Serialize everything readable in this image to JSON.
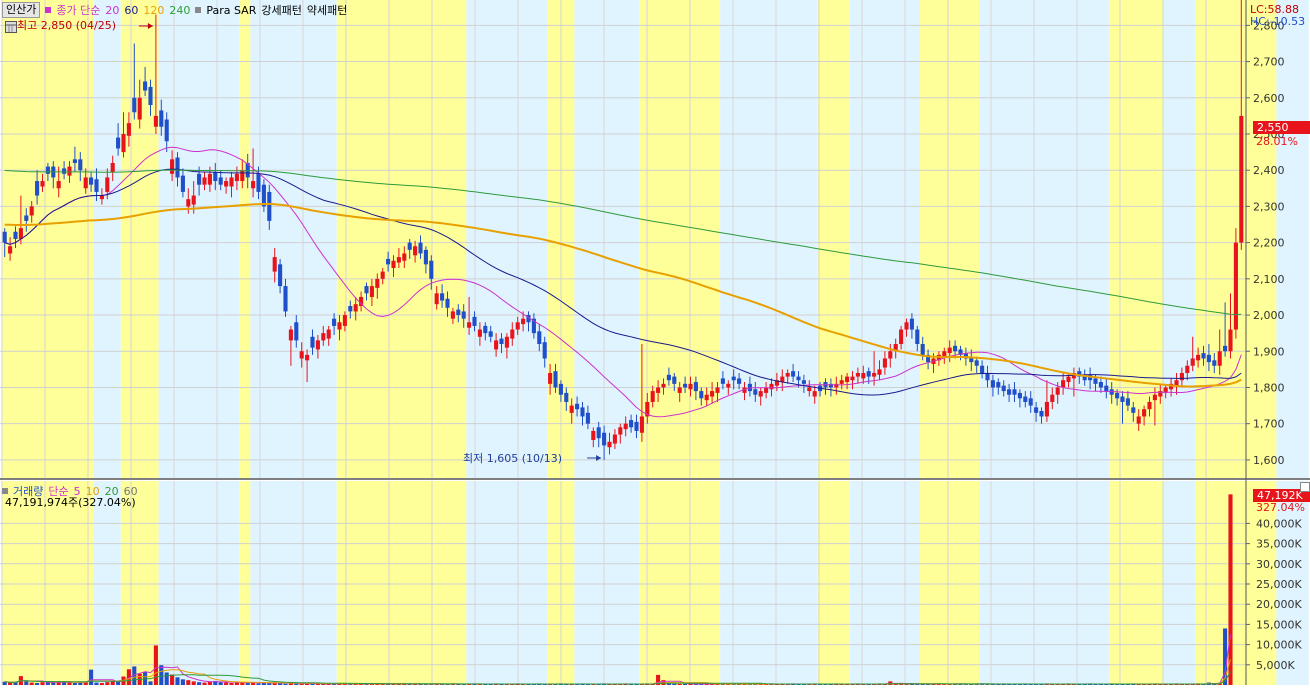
{
  "price_panel": {
    "button_label": "인산가",
    "legend_label": "종가 단순",
    "ma_periods": [
      "20",
      "60",
      "120",
      "240"
    ],
    "ma_colors": [
      "#cc33cc",
      "#1a1a8c",
      "#e8a000",
      "#2e9a3c"
    ],
    "sar_label": "Para SAR",
    "pattern_strong": "강세패턴",
    "pattern_weak": "약세패턴",
    "high_annotation": "최고 2,850 (04/25)",
    "low_annotation": "최저 1,605 (10/13)",
    "lc_text": "LC:58.88",
    "hc_text": "HC:-10.53",
    "last_price_box": "2,550",
    "last_change": "28.01%"
  },
  "volume_panel": {
    "legend_label": "거래량",
    "legend_ma_label": "단순",
    "ma_periods": [
      "5",
      "10",
      "20",
      "60"
    ],
    "ma_colors": [
      "#cc33cc",
      "#e8a000",
      "#2e9a3c",
      "#888888"
    ],
    "info_text": "47,191,974주(327.04%)",
    "last_volume_box": "47,192K",
    "last_volume_change": "327.04%"
  },
  "colors": {
    "up": "#e8141b",
    "down": "#1f4fc9",
    "strong_band": "#ffff99",
    "weak_band": "#e0f4ff",
    "ma20": "#cc33cc",
    "ma60": "#1a1a8c",
    "ma120": "#e8a000",
    "ma240": "#2e9a3c",
    "last_box": "#e8141b"
  },
  "chart_data": [
    {
      "type": "candlestick",
      "ylim": [
        1550,
        2870
      ],
      "y_ticks": [
        1600,
        1700,
        1800,
        1900,
        2000,
        2100,
        2200,
        2300,
        2400,
        2500,
        2600,
        2700,
        2800
      ],
      "y_tick_labels": [
        "1,600",
        "1,700",
        "1,800",
        "1,900",
        "2,000",
        "2,100",
        "2,200",
        "2,300",
        "2,400",
        "2,500",
        "2,600",
        "2,700",
        "2,800"
      ],
      "band_pattern": [
        [
          "s",
          0,
          17
        ],
        [
          "w",
          17,
          22
        ],
        [
          "s",
          22,
          29
        ],
        [
          "w",
          29,
          44
        ],
        [
          "s",
          44,
          46
        ],
        [
          "w",
          46,
          62
        ],
        [
          "s",
          62,
          86
        ],
        [
          "w",
          86,
          101
        ],
        [
          "s",
          101,
          106
        ],
        [
          "w",
          106,
          118
        ],
        [
          "s",
          118,
          133
        ],
        [
          "w",
          133,
          151
        ],
        [
          "s",
          151,
          157
        ],
        [
          "w",
          157,
          170
        ],
        [
          "s",
          170,
          181
        ],
        [
          "w",
          181,
          205
        ],
        [
          "s",
          205,
          215
        ],
        [
          "w",
          215,
          221
        ],
        [
          "s",
          221,
          236
        ],
        [
          "w",
          236,
          242
        ]
      ],
      "close": [
        2200,
        2190,
        2210,
        2240,
        2260,
        2300,
        2330,
        2370,
        2390,
        2380,
        2370,
        2390,
        2410,
        2420,
        2400,
        2380,
        2360,
        2340,
        2330,
        2380,
        2420,
        2460,
        2500,
        2530,
        2560,
        2600,
        2620,
        2580,
        2550,
        2520,
        2480,
        2430,
        2380,
        2340,
        2320,
        2330,
        2360,
        2380,
        2390,
        2370,
        2360,
        2370,
        2380,
        2390,
        2400,
        2380,
        2370,
        2340,
        2300,
        2260,
        2160,
        2080,
        2010,
        1960,
        1930,
        1900,
        1890,
        1910,
        1930,
        1950,
        1960,
        1970,
        1980,
        2000,
        2010,
        2030,
        2050,
        2060,
        2080,
        2100,
        2120,
        2140,
        2150,
        2160,
        2170,
        2180,
        2190,
        2170,
        2140,
        2100,
        2060,
        2040,
        2020,
        2010,
        2000,
        1990,
        1980,
        1970,
        1960,
        1950,
        1940,
        1930,
        1920,
        1940,
        1960,
        1980,
        1990,
        1980,
        1950,
        1920,
        1880,
        1840,
        1800,
        1780,
        1760,
        1750,
        1740,
        1720,
        1700,
        1680,
        1660,
        1640,
        1650,
        1670,
        1690,
        1700,
        1690,
        1680,
        1720,
        1760,
        1790,
        1800,
        1810,
        1820,
        1810,
        1800,
        1800,
        1810,
        1790,
        1770,
        1780,
        1790,
        1800,
        1810,
        1810,
        1820,
        1810,
        1800,
        1790,
        1780,
        1790,
        1800,
        1810,
        1820,
        1830,
        1840,
        1830,
        1820,
        1810,
        1800,
        1790,
        1790,
        1800,
        1800,
        1810,
        1820,
        1830,
        1830,
        1840,
        1840,
        1830,
        1840,
        1850,
        1880,
        1900,
        1920,
        1960,
        1980,
        1960,
        1920,
        1890,
        1870,
        1880,
        1890,
        1900,
        1910,
        1900,
        1890,
        1880,
        1870,
        1860,
        1840,
        1820,
        1800,
        1800,
        1790,
        1780,
        1780,
        1770,
        1760,
        1750,
        1730,
        1720,
        1760,
        1780,
        1800,
        1820,
        1830,
        1840,
        1830,
        1820,
        1820,
        1810,
        1800,
        1790,
        1780,
        1770,
        1760,
        1750,
        1730,
        1720,
        1740,
        1760,
        1780,
        1790,
        1800,
        1810,
        1820,
        1840,
        1860,
        1880,
        1890,
        1880,
        1870,
        1860,
        1900,
        1900,
        1960,
        2200,
        2550
      ],
      "open_shift": [
        30,
        -20,
        20,
        -30,
        15,
        -25,
        40,
        -15,
        20,
        30,
        -20,
        15,
        -25,
        10,
        30,
        -30,
        20,
        35,
        -10,
        -40,
        -25,
        30,
        -50,
        -35,
        40,
        -60,
        25,
        50,
        -30,
        45,
        60,
        -40,
        55,
        45,
        -20,
        -25,
        30,
        -20,
        -30,
        25,
        20,
        -15,
        -25,
        -20,
        -30,
        40,
        -20,
        50,
        60,
        80,
        -40,
        60,
        70,
        -30,
        50,
        -20,
        -15,
        30,
        -25,
        -20,
        -25,
        20,
        -20,
        -30,
        15,
        -20,
        -25,
        20,
        -30,
        -25,
        -20,
        15,
        -20,
        -15,
        -20,
        20,
        -25,
        30,
        40,
        50,
        -30,
        20,
        25,
        -20,
        15,
        20,
        -15,
        25,
        -20,
        20,
        15,
        -25,
        15,
        -30,
        -25,
        -20,
        -15,
        20,
        40,
        35,
        45,
        -30,
        45,
        30,
        25,
        -20,
        15,
        25,
        30,
        -25,
        30,
        35,
        -15,
        -25,
        -20,
        -15,
        20,
        25,
        -45,
        -40,
        -30,
        -15,
        -10,
        15,
        20,
        -15,
        10,
        -15,
        25,
        20,
        -15,
        -15,
        -15,
        15,
        -10,
        10,
        15,
        -15,
        20,
        15,
        -15,
        -15,
        -15,
        -15,
        -15,
        -10,
        15,
        10,
        10,
        -10,
        -15,
        15,
        15,
        10,
        -10,
        -10,
        -15,
        -10,
        -10,
        -15,
        15,
        -10,
        -15,
        -25,
        -20,
        -20,
        -40,
        -20,
        30,
        40,
        30,
        20,
        -15,
        -15,
        -15,
        -15,
        15,
        15,
        15,
        15,
        15,
        20,
        20,
        20,
        15,
        15,
        15,
        15,
        15,
        15,
        20,
        15,
        15,
        -40,
        -20,
        -20,
        -20,
        -15,
        -15,
        15,
        15,
        15,
        15,
        15,
        15,
        15,
        15,
        15,
        20,
        15,
        -20,
        -20,
        -20,
        -15,
        -15,
        -15,
        -15,
        -15,
        -20,
        -20,
        -20,
        -15,
        15,
        20,
        15,
        -40,
        15,
        -60,
        -240,
        -350
      ],
      "wick_up": [
        10,
        25,
        15,
        90,
        20,
        15,
        30,
        20,
        10,
        15,
        40,
        20,
        15,
        35,
        20,
        25,
        15,
        30,
        20,
        25,
        20,
        40,
        60,
        30,
        150,
        50,
        40,
        20,
        280,
        30,
        20,
        25,
        15,
        20,
        30,
        40,
        20,
        15,
        20,
        25,
        20,
        10,
        15,
        20,
        30,
        25,
        90,
        20,
        15,
        20,
        25,
        15,
        20,
        10,
        20,
        25,
        15,
        20,
        15,
        20,
        10,
        15,
        20,
        10,
        15,
        20,
        15,
        10,
        20,
        15,
        10,
        20,
        15,
        25,
        20,
        10,
        15,
        20,
        10,
        15,
        20,
        25,
        20,
        10,
        15,
        20,
        70,
        15,
        20,
        10,
        15,
        20,
        15,
        10,
        20,
        15,
        20,
        10,
        15,
        20,
        15,
        25,
        20,
        10,
        15,
        20,
        20,
        15,
        20,
        10,
        15,
        20,
        25,
        15,
        10,
        20,
        15,
        20,
        200,
        25,
        15,
        20,
        15,
        20,
        10,
        15,
        20,
        20,
        15,
        10,
        20,
        25,
        15,
        20,
        10,
        20,
        15,
        15,
        20,
        20,
        10,
        15,
        15,
        20,
        20,
        10,
        20,
        15,
        15,
        20,
        15,
        10,
        10,
        15,
        20,
        15,
        10,
        15,
        15,
        20,
        10,
        60,
        25,
        20,
        20,
        15,
        10,
        10,
        15,
        10,
        20,
        15,
        15,
        10,
        10,
        20,
        15,
        10,
        15,
        20,
        10,
        15,
        20,
        15,
        10,
        15,
        15,
        20,
        10,
        15,
        20,
        15,
        10,
        60,
        20,
        15,
        20,
        10,
        15,
        10,
        15,
        20,
        10,
        15,
        20,
        20,
        10,
        15,
        20,
        15,
        20,
        10,
        15,
        20,
        20,
        10,
        15,
        20,
        15,
        15,
        60,
        20,
        20,
        30,
        20,
        60,
        120,
        100,
        40
      ],
      "wick_down": [
        40,
        20,
        25,
        15,
        30,
        20,
        25,
        15,
        20,
        30,
        25,
        15,
        20,
        25,
        30,
        15,
        20,
        25,
        15,
        20,
        25,
        20,
        15,
        30,
        20,
        25,
        15,
        30,
        20,
        25,
        30,
        20,
        25,
        15,
        20,
        25,
        30,
        15,
        20,
        25,
        15,
        20,
        30,
        25,
        20,
        30,
        25,
        20,
        15,
        25,
        30,
        20,
        15,
        70,
        20,
        25,
        60,
        20,
        25,
        15,
        20,
        25,
        30,
        15,
        20,
        25,
        15,
        20,
        25,
        30,
        15,
        20,
        25,
        15,
        20,
        25,
        20,
        15,
        25,
        30,
        15,
        20,
        25,
        15,
        20,
        25,
        20,
        15,
        25,
        20,
        15,
        20,
        25,
        30,
        20,
        15,
        20,
        25,
        15,
        20,
        25,
        30,
        15,
        20,
        25,
        30,
        20,
        25,
        15,
        20,
        25,
        40,
        20,
        15,
        25,
        20,
        15,
        20,
        25,
        20,
        15,
        25,
        20,
        15,
        20,
        25,
        15,
        20,
        25,
        20,
        15,
        20,
        25,
        15,
        20,
        25,
        15,
        20,
        15,
        20,
        25,
        15,
        20,
        15,
        25,
        20,
        15,
        20,
        25,
        15,
        20,
        15,
        20,
        25,
        20,
        15,
        20,
        25,
        20,
        15,
        20,
        25,
        15,
        20,
        25,
        20,
        15,
        20,
        25,
        20,
        15,
        20,
        25,
        15,
        20,
        25,
        20,
        15,
        20,
        25,
        20,
        15,
        20,
        25,
        20,
        15,
        20,
        20,
        25,
        15,
        20,
        25,
        20,
        15,
        20,
        25,
        20,
        15,
        50,
        20,
        15,
        25,
        20,
        15,
        20,
        25,
        20,
        60,
        15,
        25,
        20,
        25,
        20,
        70,
        20,
        15,
        20,
        25,
        20,
        20,
        15,
        20,
        20,
        25,
        20,
        25,
        15,
        20,
        25,
        20,
        15,
        20,
        25,
        20,
        20,
        20,
        20,
        40
      ]
    },
    {
      "type": "bar",
      "ylim": [
        0,
        50500
      ],
      "y_ticks": [
        5000,
        10000,
        15000,
        20000,
        25000,
        30000,
        35000,
        40000
      ],
      "y_tick_labels": [
        "5,000K",
        "10,000K",
        "15,000K",
        "20,000K",
        "25,000K",
        "30,000K",
        "35,000K",
        "40,000K"
      ],
      "volumes": [
        800,
        600,
        700,
        2200,
        900,
        600,
        500,
        700,
        800,
        600,
        900,
        700,
        600,
        500,
        700,
        800,
        3800,
        600,
        500,
        700,
        900,
        1100,
        2100,
        3900,
        4600,
        2800,
        3200,
        900,
        9800,
        4900,
        3100,
        2600,
        1900,
        1400,
        1200,
        900,
        700,
        600,
        800,
        1000,
        700,
        600,
        500,
        700,
        600,
        500,
        700,
        400,
        500,
        600,
        500,
        400,
        300,
        500,
        400,
        300,
        400,
        350,
        300,
        250,
        300,
        350,
        300,
        250,
        300,
        350,
        300,
        400,
        350,
        300,
        250,
        300,
        350,
        300,
        250,
        200,
        300,
        250,
        200,
        250,
        300,
        250,
        200,
        300,
        250,
        200,
        250,
        300,
        250,
        200,
        250,
        300,
        250,
        200,
        250,
        300,
        250,
        200,
        250,
        300,
        250,
        200,
        250,
        300,
        250,
        200,
        250,
        300,
        250,
        200,
        250,
        300,
        250,
        200,
        250,
        300,
        250,
        200,
        250,
        300,
        250,
        2500,
        1200,
        400,
        300,
        250,
        300,
        250,
        200,
        250,
        300,
        250,
        200,
        250,
        300,
        250,
        200,
        250,
        300,
        250,
        200,
        250,
        300,
        250,
        200,
        250,
        300,
        250,
        200,
        250,
        300,
        250,
        200,
        250,
        300,
        250,
        200,
        250,
        300,
        250,
        200,
        250,
        300,
        250,
        900,
        300,
        250,
        200,
        250,
        300,
        250,
        200,
        250,
        300,
        250,
        200,
        250,
        300,
        250,
        200,
        250,
        300,
        250,
        200,
        250,
        300,
        250,
        200,
        250,
        300,
        250,
        200,
        250,
        300,
        250,
        200,
        250,
        300,
        250,
        200,
        250,
        300,
        250,
        200,
        250,
        300,
        250,
        200,
        250,
        300,
        250,
        200,
        250,
        300,
        250,
        200,
        250,
        300,
        250,
        200,
        250,
        300,
        250,
        600,
        400,
        500,
        14000,
        47192
      ]
    }
  ]
}
